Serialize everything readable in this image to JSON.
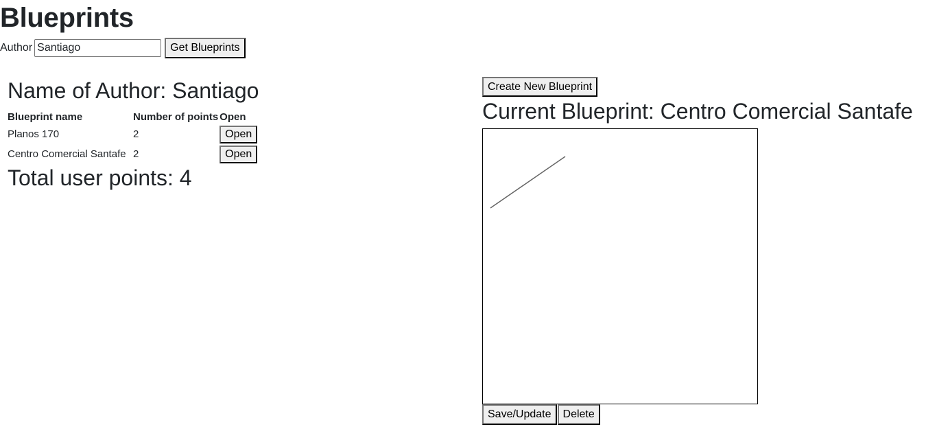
{
  "page": {
    "title": "Blueprints"
  },
  "search": {
    "label": "Author",
    "value": "Santiago",
    "button_label": "Get Blueprints"
  },
  "author_panel": {
    "heading": "Name of Author: Santiago",
    "table": {
      "headers": [
        "Blueprint name",
        "Number of points",
        "Open"
      ],
      "rows": [
        {
          "name": "Planos 170",
          "points": "2",
          "action": "Open"
        },
        {
          "name": "Centro Comercial Santafe",
          "points": "2",
          "action": "Open"
        }
      ]
    },
    "total": "Total user points: 4"
  },
  "editor": {
    "create_label": "Create New Blueprint",
    "heading": "Current Blueprint: Centro Comercial Santafe",
    "save_label": "Save/Update",
    "delete_label": "Delete",
    "stroke_color": "#666666"
  }
}
